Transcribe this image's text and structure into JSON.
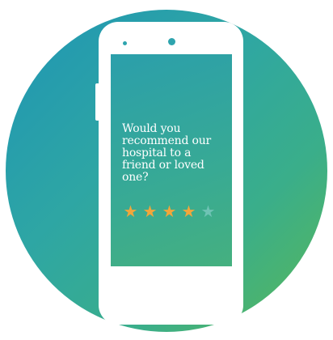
{
  "survey": {
    "question": "Would you recommend our hospital to a friend or loved one?",
    "rating": {
      "value": 4,
      "max": 5,
      "filled_color": "#f2a63b",
      "empty_color": "#6fc3b5"
    }
  },
  "icons": {
    "star": "star-icon"
  }
}
